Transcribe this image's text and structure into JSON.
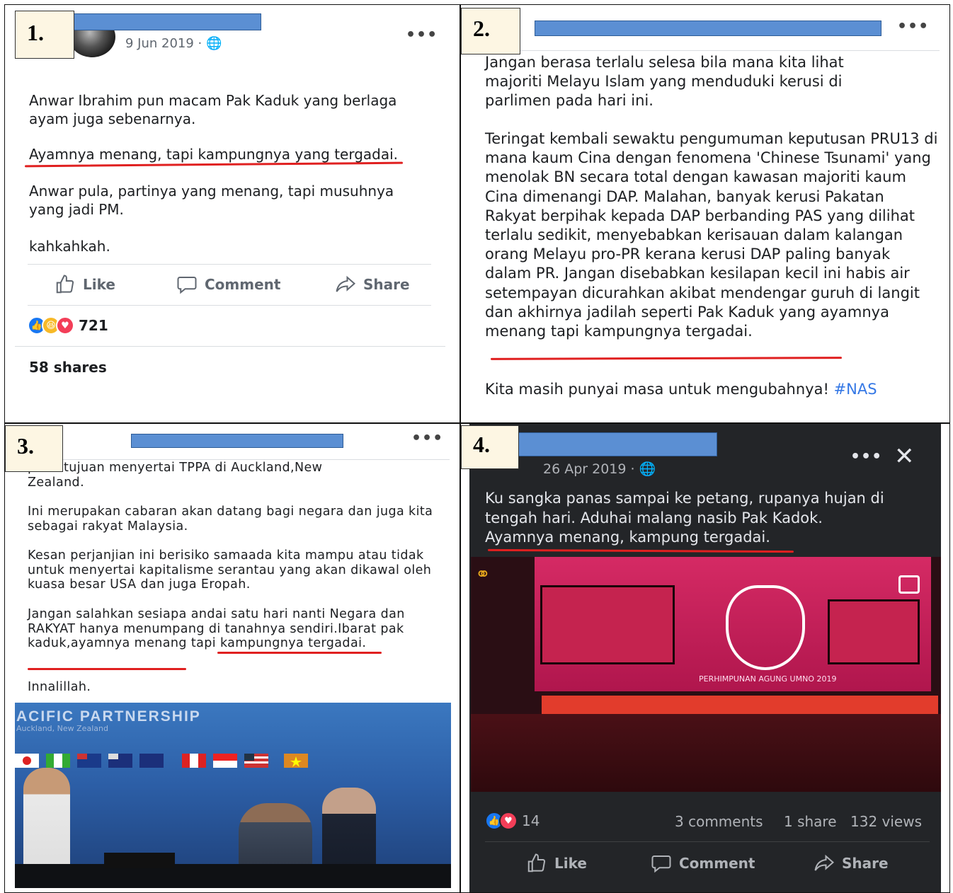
{
  "panel1": {
    "number": "1.",
    "date": "9 Jun 2019 · ",
    "para1": "Anwar Ibrahim pun macam Pak Kaduk yang berlaga ayam juga sebenarnya.",
    "para2": "Ayamnya menang, tapi kampungnya yang tergadai.",
    "para3": "Anwar pula, partinya yang menang, tapi musuhnya yang jadi PM.",
    "para4": "kahkahkah.",
    "actions": {
      "like": "Like",
      "comment": "Comment",
      "share": "Share"
    },
    "reactions_count": "721",
    "shares": "58 shares"
  },
  "panel2": {
    "number": "2.",
    "para1": "Jangan berasa terlalu selesa bila mana kita lihat majoriti Melayu Islam yang menduduki kerusi di parlimen pada hari ini.",
    "para2": "Teringat kembali sewaktu pengumuman keputusan PRU13 di mana kaum Cina dengan fenomena 'Chinese Tsunami' yang menolak BN secara total dengan kawasan majoriti kaum Cina dimenangi DAP. Malahan, banyak kerusi Pakatan Rakyat berpihak kepada DAP berbanding PAS yang dilihat terlalu sedikit, menyebabkan kerisauan dalam kalangan orang Melayu pro-PR kerana kerusi DAP paling banyak dalam PR. Jangan disebabkan kesilapan kecil ini habis air setempayan dicurahkan akibat mendengar guruh di langit dan akhirnya jadilah seperti Pak Kaduk yang ayamnya menang tapi kampungnya tergadai.",
    "para3": "Kita masih punyai masa untuk mengubahnya! ",
    "hashtag": "#NAS"
  },
  "panel3": {
    "number": "3.",
    "para1": "persetujuan menyertai TPPA di Auckland,New Zealand.",
    "para2": "Ini merupakan cabaran akan datang bagi negara dan juga kita sebagai rakyat Malaysia.",
    "para3": "Kesan perjanjian ini berisiko samaada kita mampu atau tidak untuk menyertai kapitalisme serantau yang akan dikawal oleh kuasa besar USA dan juga Eropah.",
    "para4a": "Jangan salahkan sesiapa andai satu hari nanti Negara dan RAKYAT hanya menumpang di tanahnya sendiri.Ibarat pak kaduk,",
    "para4b": "ayamnya menang tapi kampungnya tergadai.",
    "para5": "Innalillah.",
    "photo_banner_1": "ACIFIC PARTNERSHIP",
    "photo_banner_2": "Auckland, New Zealand"
  },
  "panel4": {
    "number": "4.",
    "date": "26 Apr 2019 · ",
    "line1": "Ku sangka panas sampai ke petang, rupanya hujan di tengah hari. Aduhai malang nasib Pak Kadok.",
    "line2": "Ayamnya menang, kampung tergadai.",
    "photo_banner": "PERHIMPUNAN AGUNG UMNO 2019",
    "reactions_count": "14",
    "comments": "3 comments",
    "shares": "1 share",
    "views": "132 views",
    "actions": {
      "like": "Like",
      "comment": "Comment",
      "share": "Share"
    }
  },
  "colors": {
    "underline": "#e02020",
    "redaction": "#5b8fd3",
    "hashtag": "#3578e5",
    "dark_bg": "#232528"
  }
}
